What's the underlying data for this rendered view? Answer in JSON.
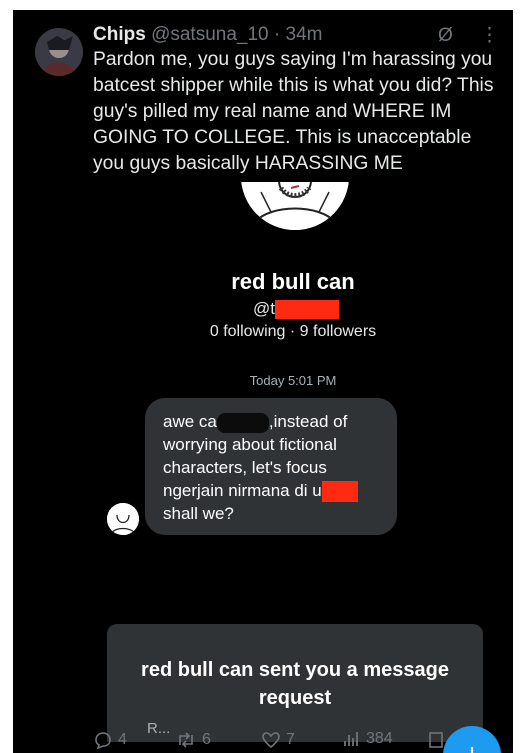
{
  "tweet": {
    "author_name": "Chips",
    "author_handle": "@satsuna_10",
    "separator": "·",
    "time": "34m",
    "text": "Pardon me, you guys saying I'm harassing you batcest shipper while this is what you did? This guy's pilled my real name and WHERE IM GOING TO COLLEGE. This is unacceptable you guys basically HARASSING ME"
  },
  "header_icons": [
    "grok-slash-icon",
    "more-vertical-icon"
  ],
  "header_icon_glyphs": {
    "grok": "Ø",
    "more": "⋮"
  },
  "dm": {
    "profile_name": "red bull can",
    "handle_prefix": "@t",
    "stats": "0 following · 9 followers",
    "timestamp": "Today 5:01 PM",
    "message": {
      "line1_start": "awe ca",
      "line1_end": ",instead of",
      "line2": "worrying about fictional",
      "line3": "characters, let's focus",
      "line4": "ngerjain nirmana di u",
      "line5": "shall we?"
    },
    "request_title": "red bull can sent you a message request",
    "request_subtitle": "R..."
  },
  "actions": {
    "replies": "4",
    "reposts": "6",
    "likes": "7",
    "views": "384"
  },
  "fab_label": "+",
  "colors": {
    "background": "#000000",
    "text": "#e7e9ea",
    "muted": "#71767b",
    "bubble": "#2f3336",
    "redaction": "#ff2a12",
    "accent": "#1d9bf0"
  }
}
